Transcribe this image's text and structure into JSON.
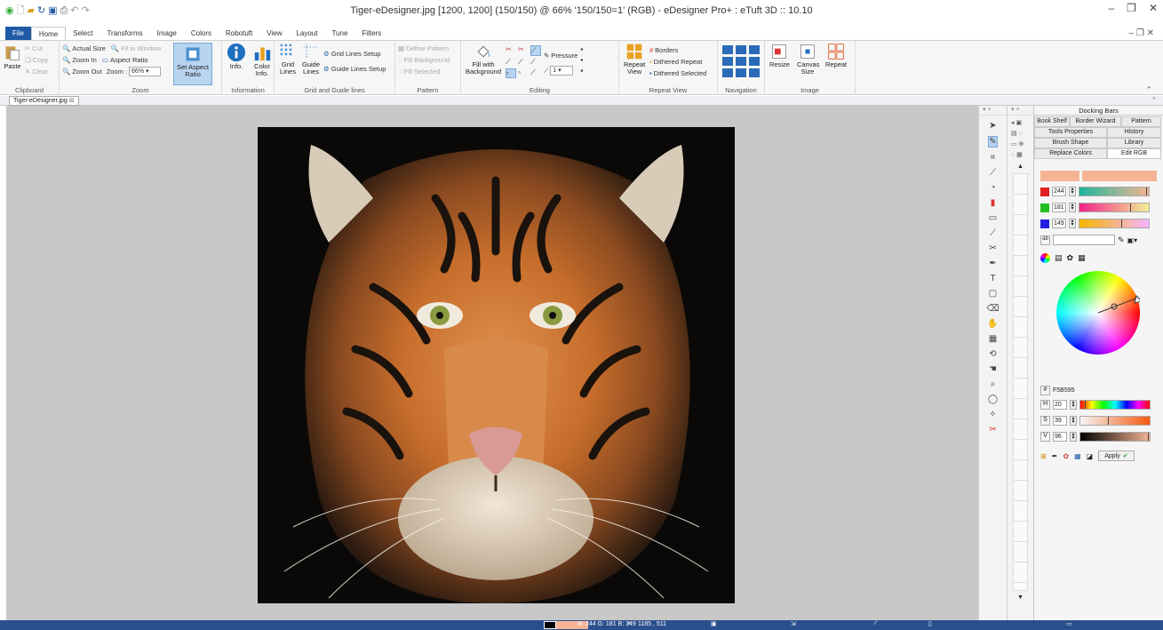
{
  "window": {
    "title": "Tiger-eDesigner.jpg [1200, 1200] (150/150) @ 66% '150/150=1' (RGB) - eDesigner Pro+ : eTuft 3D :: 10.10"
  },
  "tabs": [
    "File",
    "Home",
    "Select",
    "Transforms",
    "Image",
    "Colors",
    "Robotuft",
    "View",
    "Layout",
    "Tune",
    "Filters"
  ],
  "ribbon": {
    "clipboard": {
      "title": "Clipboard",
      "paste": "Paste",
      "cut": "Cut",
      "copy": "Copy",
      "clear": "Clear"
    },
    "zoom": {
      "title": "Zoom",
      "actual_size": "Actual Size",
      "fit_window": "Fit in Window",
      "zoom_in": "Zoom In",
      "aspect_ratio": "Aspect Ratio",
      "zoom_out": "Zoom Out",
      "zoom_label": "Zoom :",
      "zoom_value": "66%",
      "set_aspect": "Set Aspect Ratio"
    },
    "information": {
      "title": "Information",
      "info": "Info.",
      "color_info": "Color Info."
    },
    "grid": {
      "title": "Grid and Guide lines",
      "grid_lines": "Grid Lines",
      "guide_lines": "Guide Lines",
      "grid_setup": "Grid Lines Setup",
      "guide_setup": "Guide Lines Setup"
    },
    "pattern": {
      "title": "Pattern",
      "define": "Define Pattern",
      "fill_bg": "Fill Background",
      "fill_sel": "Fill Selected"
    },
    "editing": {
      "title": "Editing",
      "fill_with_bg": "Fill with Background",
      "pressure": "Pressure",
      "size_value": "1"
    },
    "repeat_view": {
      "title": "Repeat View",
      "repeat_view": "Repeat View",
      "borders": "Borders",
      "dithered_repeat": "Dithered Repeat",
      "dithered_selected": "Dithered Selected"
    },
    "navigation": {
      "title": "Navigation"
    },
    "image": {
      "title": "Image",
      "resize": "Resize",
      "canvas_size": "Canvas Size",
      "repeat": "Repeat"
    }
  },
  "doc_tab": "Tiger-eDesigner.jpg",
  "panel": {
    "title": "Docking Bars",
    "tabs_row1": [
      "Book Shelf",
      "Border Wizard",
      "Pattern"
    ],
    "tabs_row2": [
      "Tools Properties",
      "History"
    ],
    "tabs_row3": [
      "Brush Shape",
      "Library"
    ],
    "tabs_row4": [
      "Replace Colors",
      "Edit RGB"
    ],
    "r": "244",
    "g": "181",
    "b": "149",
    "hex": "F5B595",
    "h": "20",
    "s": "39",
    "v": "96",
    "apply": "Apply",
    "colors": {
      "current": "#f5b595",
      "red": "#e02020",
      "green": "#20c020",
      "blue": "#2020e0"
    }
  },
  "status": {
    "rgb": "R: 244 G: 181 B: 149",
    "coords": "1185 , 511"
  }
}
